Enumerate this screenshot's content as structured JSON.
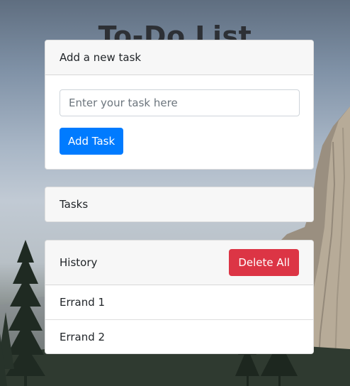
{
  "page": {
    "title": "To-Do List"
  },
  "add_card": {
    "header": "Add a new task",
    "input_value": "",
    "input_placeholder": "Enter your task here",
    "button_label": "Add Task"
  },
  "tasks_card": {
    "header": "Tasks",
    "items": []
  },
  "history_card": {
    "header": "History",
    "delete_all_label": "Delete All",
    "items": [
      {
        "label": "Errand 1"
      },
      {
        "label": "Errand 2"
      }
    ]
  },
  "colors": {
    "primary": "#007bff",
    "danger": "#dc3545",
    "title": "#2d3035",
    "card_header_bg": "#f7f7f7"
  }
}
